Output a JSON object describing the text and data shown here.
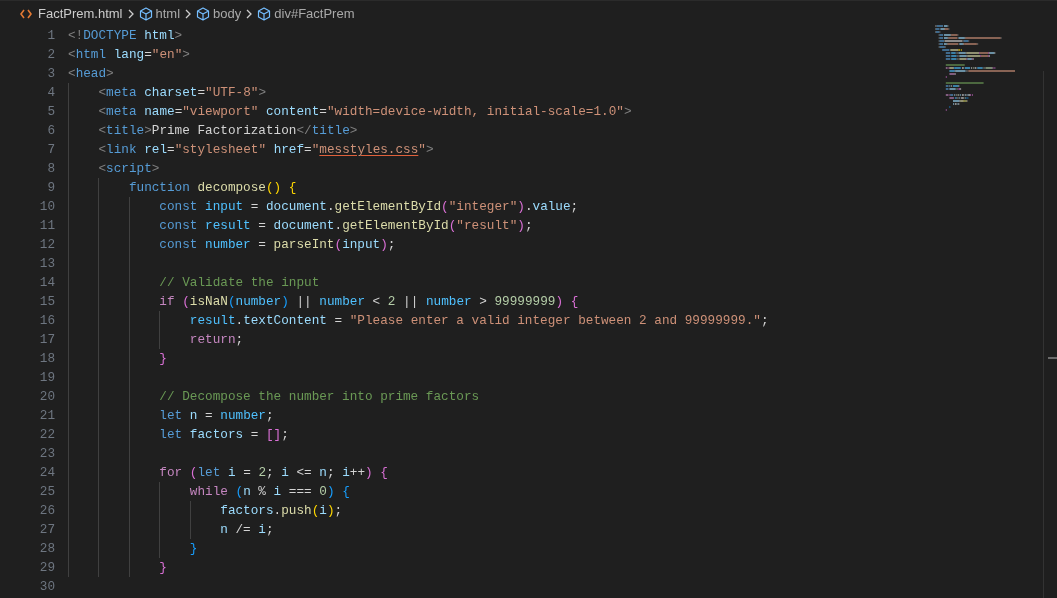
{
  "breadcrumb": [
    {
      "kind": "file",
      "label": "FactPrem.html"
    },
    {
      "kind": "element",
      "label": "html"
    },
    {
      "kind": "element",
      "label": "body"
    },
    {
      "kind": "element",
      "label": "div#FactPrem"
    }
  ],
  "lines": [
    {
      "number": "1",
      "tokens": [
        {
          "kind": "punct",
          "text": "<!"
        },
        {
          "kind": "tag",
          "text": "DOCTYPE"
        },
        {
          "kind": "attr",
          "text": " html"
        },
        {
          "kind": "punct",
          "text": ">"
        }
      ]
    },
    {
      "number": "2",
      "tokens": [
        {
          "kind": "punct",
          "text": "<"
        },
        {
          "kind": "tag",
          "text": "html"
        },
        {
          "kind": "attr",
          "text": " lang"
        },
        {
          "kind": "text",
          "text": "="
        },
        {
          "kind": "str",
          "text": "\"en\""
        },
        {
          "kind": "punct",
          "text": ">"
        }
      ]
    },
    {
      "number": "3",
      "tokens": [
        {
          "kind": "punct",
          "text": "<"
        },
        {
          "kind": "tag",
          "text": "head"
        },
        {
          "kind": "punct",
          "text": ">"
        }
      ]
    },
    {
      "number": "4",
      "tokens": [
        {
          "kind": "punct",
          "text": "    <"
        },
        {
          "kind": "tag",
          "text": "meta"
        },
        {
          "kind": "attr",
          "text": " charset"
        },
        {
          "kind": "text",
          "text": "="
        },
        {
          "kind": "str",
          "text": "\"UTF-8\""
        },
        {
          "kind": "punct",
          "text": ">"
        }
      ]
    },
    {
      "number": "5",
      "tokens": [
        {
          "kind": "punct",
          "text": "    <"
        },
        {
          "kind": "tag",
          "text": "meta"
        },
        {
          "kind": "attr",
          "text": " name"
        },
        {
          "kind": "text",
          "text": "="
        },
        {
          "kind": "str",
          "text": "\"viewport\""
        },
        {
          "kind": "attr",
          "text": " content"
        },
        {
          "kind": "text",
          "text": "="
        },
        {
          "kind": "str",
          "text": "\"width=device-width, initial-scale=1.0\""
        },
        {
          "kind": "punct",
          "text": ">"
        }
      ]
    },
    {
      "number": "6",
      "tokens": [
        {
          "kind": "punct",
          "text": "    <"
        },
        {
          "kind": "tag",
          "text": "title"
        },
        {
          "kind": "punct",
          "text": ">"
        },
        {
          "kind": "text",
          "text": "Prime Factorization"
        },
        {
          "kind": "punct",
          "text": "</"
        },
        {
          "kind": "tag",
          "text": "title"
        },
        {
          "kind": "punct",
          "text": ">"
        }
      ]
    },
    {
      "number": "7",
      "tokens": [
        {
          "kind": "punct",
          "text": "    <"
        },
        {
          "kind": "tag",
          "text": "link"
        },
        {
          "kind": "attr",
          "text": " rel"
        },
        {
          "kind": "text",
          "text": "="
        },
        {
          "kind": "str",
          "text": "\"stylesheet\""
        },
        {
          "kind": "attr",
          "text": " href"
        },
        {
          "kind": "text",
          "text": "="
        },
        {
          "kind": "str",
          "text": "\""
        },
        {
          "kind": "link",
          "text": "messtyles.css"
        },
        {
          "kind": "str",
          "text": "\""
        },
        {
          "kind": "punct",
          "text": ">"
        }
      ]
    },
    {
      "number": "8",
      "tokens": [
        {
          "kind": "punct",
          "text": "    <"
        },
        {
          "kind": "tag",
          "text": "script"
        },
        {
          "kind": "punct",
          "text": ">"
        }
      ]
    },
    {
      "number": "9",
      "tokens": [
        {
          "kind": "kw",
          "text": "        function"
        },
        {
          "kind": "fn",
          "text": " decompose"
        },
        {
          "kind": "b1",
          "text": "()"
        },
        {
          "kind": "b1",
          "text": " {"
        }
      ]
    },
    {
      "number": "10",
      "tokens": [
        {
          "kind": "kw",
          "text": "            const"
        },
        {
          "kind": "const",
          "text": " input"
        },
        {
          "kind": "text",
          "text": " = "
        },
        {
          "kind": "var",
          "text": "document"
        },
        {
          "kind": "text",
          "text": "."
        },
        {
          "kind": "fn",
          "text": "getElementById"
        },
        {
          "kind": "b2",
          "text": "("
        },
        {
          "kind": "str",
          "text": "\"integer\""
        },
        {
          "kind": "b2",
          "text": ")"
        },
        {
          "kind": "text",
          "text": "."
        },
        {
          "kind": "var",
          "text": "value"
        },
        {
          "kind": "text",
          "text": ";"
        }
      ]
    },
    {
      "number": "11",
      "tokens": [
        {
          "kind": "kw",
          "text": "            const"
        },
        {
          "kind": "const",
          "text": " result"
        },
        {
          "kind": "text",
          "text": " = "
        },
        {
          "kind": "var",
          "text": "document"
        },
        {
          "kind": "text",
          "text": "."
        },
        {
          "kind": "fn",
          "text": "getElementById"
        },
        {
          "kind": "b2",
          "text": "("
        },
        {
          "kind": "str",
          "text": "\"result\""
        },
        {
          "kind": "b2",
          "text": ")"
        },
        {
          "kind": "text",
          "text": ";"
        }
      ]
    },
    {
      "number": "12",
      "tokens": [
        {
          "kind": "kw",
          "text": "            const"
        },
        {
          "kind": "const",
          "text": " number"
        },
        {
          "kind": "text",
          "text": " = "
        },
        {
          "kind": "fn",
          "text": "parseInt"
        },
        {
          "kind": "b2",
          "text": "("
        },
        {
          "kind": "var",
          "text": "input"
        },
        {
          "kind": "b2",
          "text": ")"
        },
        {
          "kind": "text",
          "text": ";"
        }
      ]
    },
    {
      "number": "13"
    },
    {
      "number": "14",
      "tokens": [
        {
          "kind": "cmt",
          "text": "            // Validate the input"
        }
      ]
    },
    {
      "number": "15",
      "tokens": [
        {
          "kind": "ctrl",
          "text": "            if"
        },
        {
          "kind": "b2",
          "text": " ("
        },
        {
          "kind": "fn",
          "text": "isNaN"
        },
        {
          "kind": "b3",
          "text": "("
        },
        {
          "kind": "const",
          "text": "number"
        },
        {
          "kind": "b3",
          "text": ")"
        },
        {
          "kind": "text",
          "text": " || "
        },
        {
          "kind": "const",
          "text": "number"
        },
        {
          "kind": "text",
          "text": " < "
        },
        {
          "kind": "num",
          "text": "2"
        },
        {
          "kind": "text",
          "text": " || "
        },
        {
          "kind": "const",
          "text": "number"
        },
        {
          "kind": "text",
          "text": " > "
        },
        {
          "kind": "num",
          "text": "99999999"
        },
        {
          "kind": "b2",
          "text": ")"
        },
        {
          "kind": "b2",
          "text": " {"
        }
      ]
    },
    {
      "number": "16",
      "tokens": [
        {
          "kind": "const",
          "text": "                result"
        },
        {
          "kind": "text",
          "text": "."
        },
        {
          "kind": "var",
          "text": "textContent"
        },
        {
          "kind": "text",
          "text": " = "
        },
        {
          "kind": "str",
          "text": "\"Please enter a valid integer between 2 and 99999999.\""
        },
        {
          "kind": "text",
          "text": ";"
        }
      ]
    },
    {
      "number": "17",
      "tokens": [
        {
          "kind": "ctrl",
          "text": "                return"
        },
        {
          "kind": "text",
          "text": ";"
        }
      ]
    },
    {
      "number": "18",
      "tokens": [
        {
          "kind": "b2",
          "text": "            }"
        }
      ]
    },
    {
      "number": "19"
    },
    {
      "number": "20",
      "tokens": [
        {
          "kind": "cmt",
          "text": "            // Decompose the number into prime factors"
        }
      ]
    },
    {
      "number": "21",
      "tokens": [
        {
          "kind": "kw",
          "text": "            let"
        },
        {
          "kind": "var",
          "text": " n"
        },
        {
          "kind": "text",
          "text": " = "
        },
        {
          "kind": "const",
          "text": "number"
        },
        {
          "kind": "text",
          "text": ";"
        }
      ]
    },
    {
      "number": "22",
      "tokens": [
        {
          "kind": "kw",
          "text": "            let"
        },
        {
          "kind": "var",
          "text": " factors"
        },
        {
          "kind": "text",
          "text": " = "
        },
        {
          "kind": "b2",
          "text": "[]"
        },
        {
          "kind": "text",
          "text": ";"
        }
      ]
    },
    {
      "number": "23"
    },
    {
      "number": "24",
      "tokens": [
        {
          "kind": "ctrl",
          "text": "            for"
        },
        {
          "kind": "b2",
          "text": " ("
        },
        {
          "kind": "kw",
          "text": "let"
        },
        {
          "kind": "var",
          "text": " i"
        },
        {
          "kind": "text",
          "text": " = "
        },
        {
          "kind": "num",
          "text": "2"
        },
        {
          "kind": "text",
          "text": "; "
        },
        {
          "kind": "var",
          "text": "i"
        },
        {
          "kind": "text",
          "text": " <= "
        },
        {
          "kind": "var",
          "text": "n"
        },
        {
          "kind": "text",
          "text": "; "
        },
        {
          "kind": "var",
          "text": "i"
        },
        {
          "kind": "text",
          "text": "++"
        },
        {
          "kind": "b2",
          "text": ")"
        },
        {
          "kind": "b2",
          "text": " {"
        }
      ]
    },
    {
      "number": "25",
      "tokens": [
        {
          "kind": "ctrl",
          "text": "                while"
        },
        {
          "kind": "b3",
          "text": " ("
        },
        {
          "kind": "var",
          "text": "n"
        },
        {
          "kind": "text",
          "text": " % "
        },
        {
          "kind": "var",
          "text": "i"
        },
        {
          "kind": "text",
          "text": " === "
        },
        {
          "kind": "num",
          "text": "0"
        },
        {
          "kind": "b3",
          "text": ")"
        },
        {
          "kind": "b3",
          "text": " {"
        }
      ]
    },
    {
      "number": "26",
      "tokens": [
        {
          "kind": "var",
          "text": "                    factors"
        },
        {
          "kind": "text",
          "text": "."
        },
        {
          "kind": "fn",
          "text": "push"
        },
        {
          "kind": "b1",
          "text": "("
        },
        {
          "kind": "var",
          "text": "i"
        },
        {
          "kind": "b1",
          "text": ")"
        },
        {
          "kind": "text",
          "text": ";"
        }
      ]
    },
    {
      "number": "27",
      "tokens": [
        {
          "kind": "var",
          "text": "                    n"
        },
        {
          "kind": "text",
          "text": " /= "
        },
        {
          "kind": "var",
          "text": "i"
        },
        {
          "kind": "text",
          "text": ";"
        }
      ]
    },
    {
      "number": "28",
      "tokens": [
        {
          "kind": "b3",
          "text": "                }"
        }
      ]
    },
    {
      "number": "29",
      "tokens": [
        {
          "kind": "b2",
          "text": "            }"
        }
      ]
    },
    {
      "number": "30"
    }
  ]
}
